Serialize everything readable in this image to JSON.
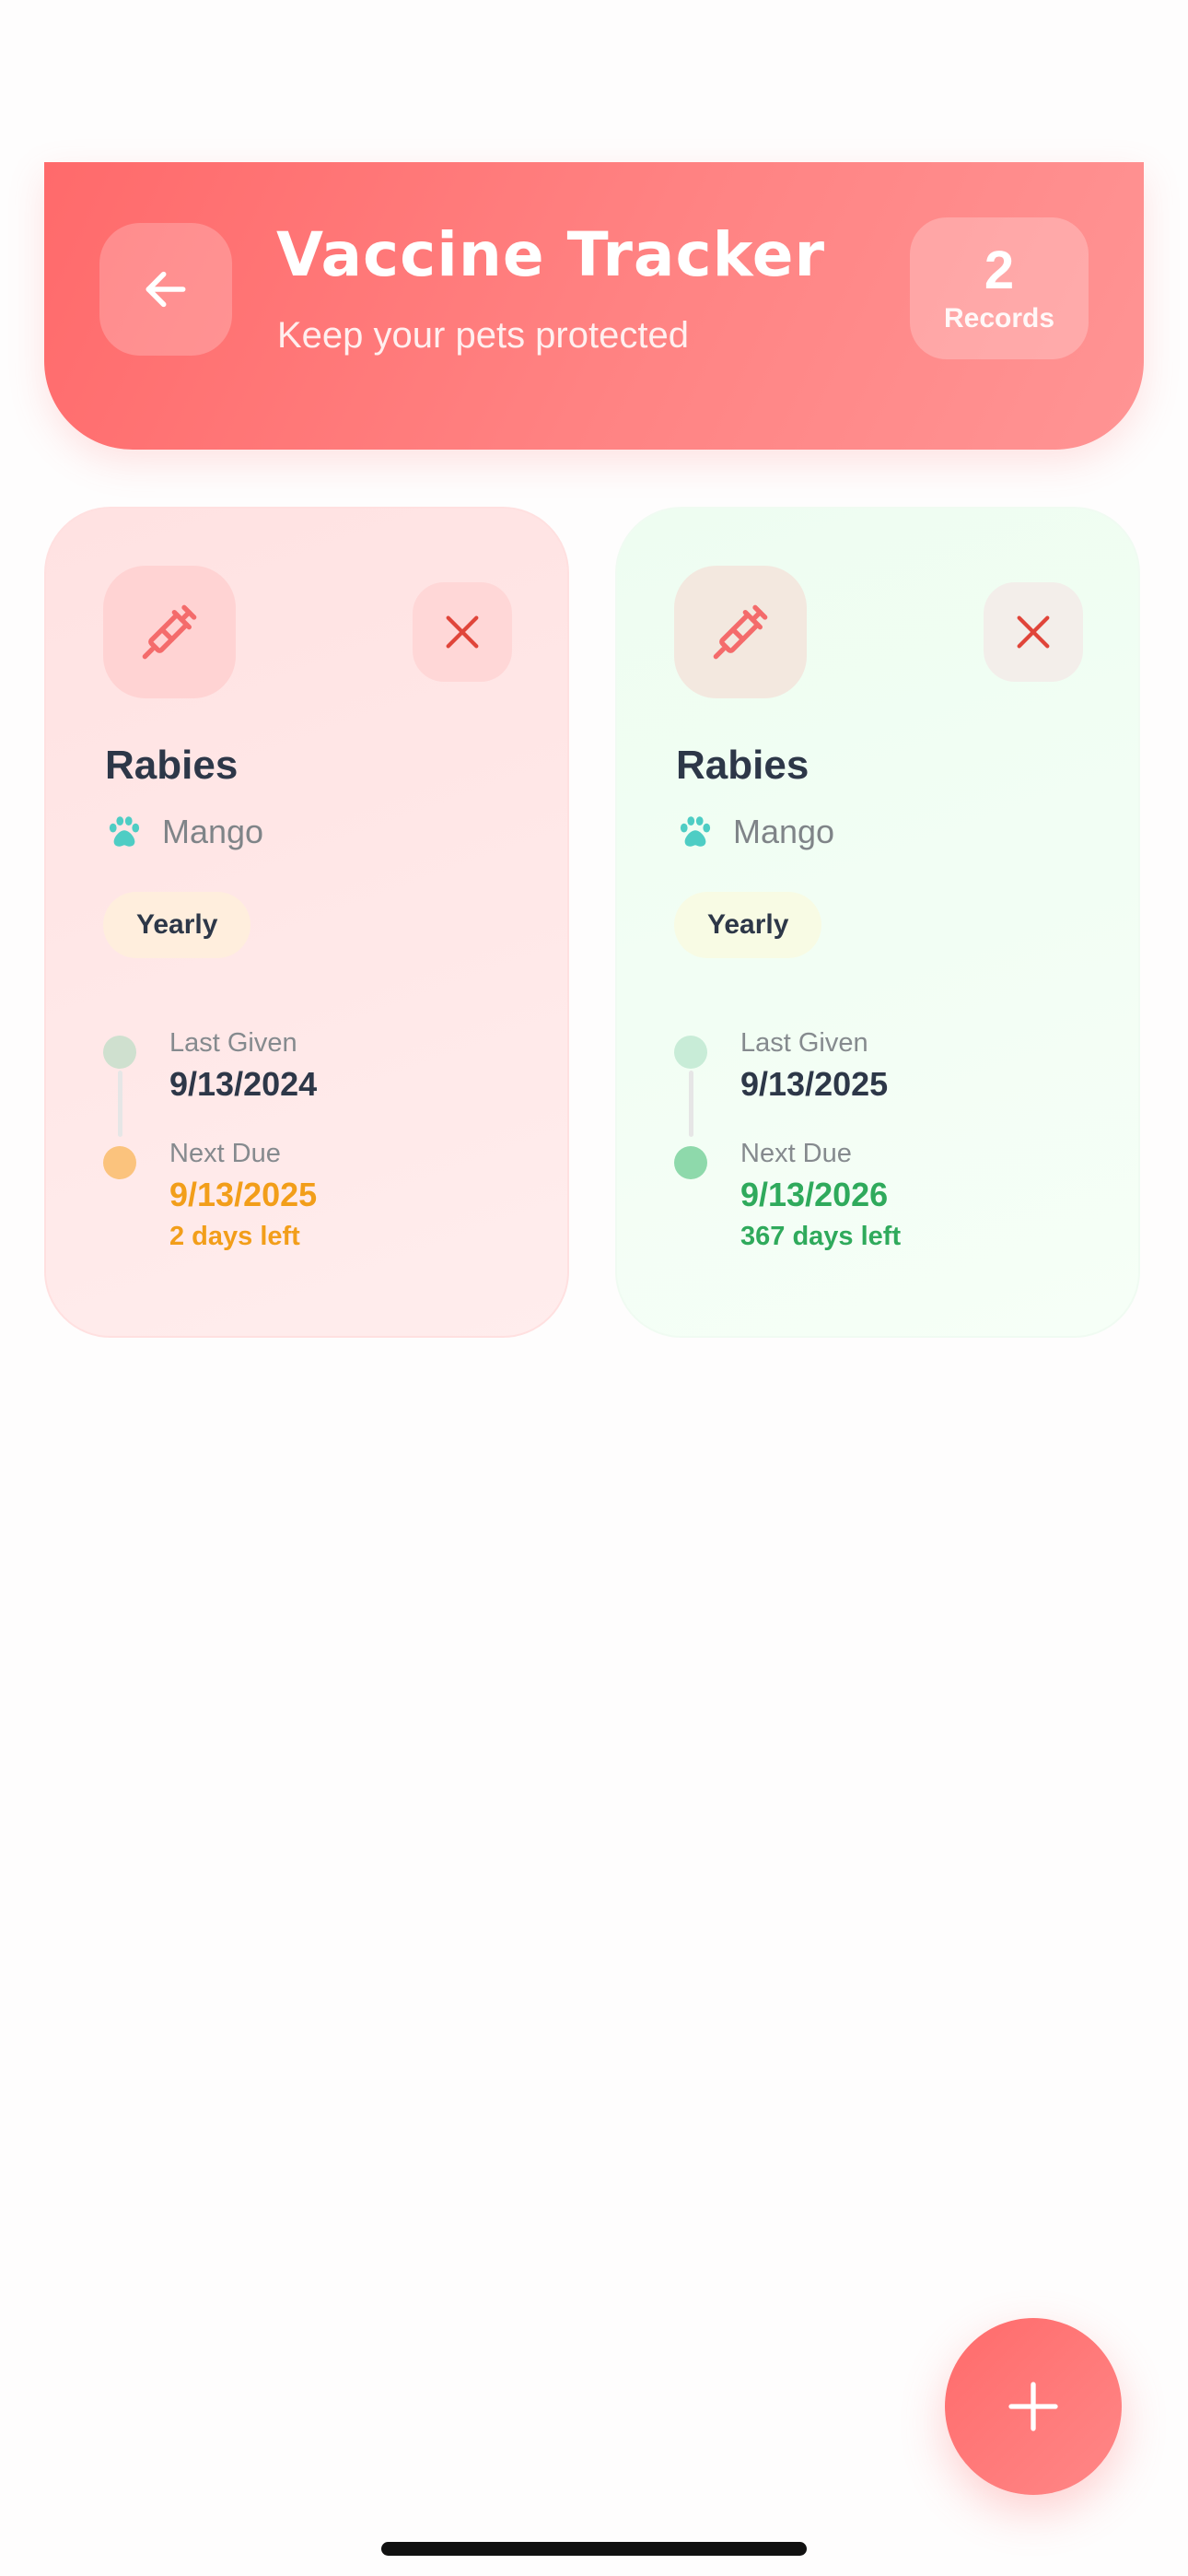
{
  "header": {
    "title": "Vaccine Tracker",
    "subtitle": "Keep your pets protected",
    "record_count": "2",
    "record_label": "Records"
  },
  "cards": [
    {
      "status": "due-soon",
      "vaccine": "Rabies",
      "pet": "Mango",
      "frequency": "Yearly",
      "last_given_label": "Last Given",
      "last_given": "9/13/2024",
      "next_due_label": "Next Due",
      "next_due": "9/13/2025",
      "days_left": "2 days left"
    },
    {
      "status": "ok",
      "vaccine": "Rabies",
      "pet": "Mango",
      "frequency": "Yearly",
      "last_given_label": "Last Given",
      "last_given": "9/13/2025",
      "next_due_label": "Next Due",
      "next_due": "9/13/2026",
      "days_left": "367 days left"
    }
  ],
  "icons": {
    "back": "arrow-left-icon",
    "vaccine": "syringe-icon",
    "delete": "close-icon",
    "pet": "paw-icon",
    "add": "plus-icon"
  },
  "colors": {
    "accent": "#ff6b6b",
    "due_soon": "#f29e1a",
    "ok": "#2faa5c",
    "pet_icon": "#4ecdc4",
    "text_dark": "#2d3748"
  }
}
